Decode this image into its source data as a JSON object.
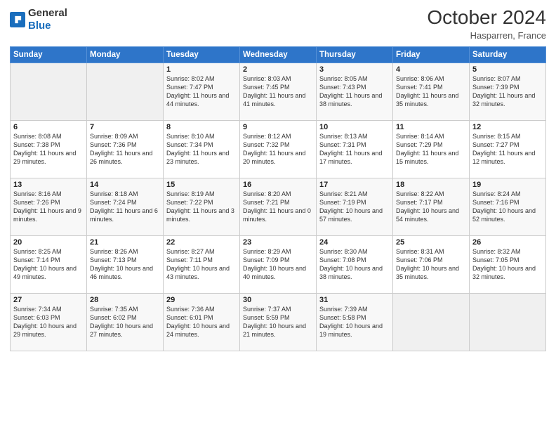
{
  "header": {
    "logo_general": "General",
    "logo_blue": "Blue",
    "month_title": "October 2024",
    "location": "Hasparren, France"
  },
  "weekdays": [
    "Sunday",
    "Monday",
    "Tuesday",
    "Wednesday",
    "Thursday",
    "Friday",
    "Saturday"
  ],
  "weeks": [
    [
      {
        "day": "",
        "sunrise": "",
        "sunset": "",
        "daylight": ""
      },
      {
        "day": "",
        "sunrise": "",
        "sunset": "",
        "daylight": ""
      },
      {
        "day": "1",
        "sunrise": "Sunrise: 8:02 AM",
        "sunset": "Sunset: 7:47 PM",
        "daylight": "Daylight: 11 hours and 44 minutes."
      },
      {
        "day": "2",
        "sunrise": "Sunrise: 8:03 AM",
        "sunset": "Sunset: 7:45 PM",
        "daylight": "Daylight: 11 hours and 41 minutes."
      },
      {
        "day": "3",
        "sunrise": "Sunrise: 8:05 AM",
        "sunset": "Sunset: 7:43 PM",
        "daylight": "Daylight: 11 hours and 38 minutes."
      },
      {
        "day": "4",
        "sunrise": "Sunrise: 8:06 AM",
        "sunset": "Sunset: 7:41 PM",
        "daylight": "Daylight: 11 hours and 35 minutes."
      },
      {
        "day": "5",
        "sunrise": "Sunrise: 8:07 AM",
        "sunset": "Sunset: 7:39 PM",
        "daylight": "Daylight: 11 hours and 32 minutes."
      }
    ],
    [
      {
        "day": "6",
        "sunrise": "Sunrise: 8:08 AM",
        "sunset": "Sunset: 7:38 PM",
        "daylight": "Daylight: 11 hours and 29 minutes."
      },
      {
        "day": "7",
        "sunrise": "Sunrise: 8:09 AM",
        "sunset": "Sunset: 7:36 PM",
        "daylight": "Daylight: 11 hours and 26 minutes."
      },
      {
        "day": "8",
        "sunrise": "Sunrise: 8:10 AM",
        "sunset": "Sunset: 7:34 PM",
        "daylight": "Daylight: 11 hours and 23 minutes."
      },
      {
        "day": "9",
        "sunrise": "Sunrise: 8:12 AM",
        "sunset": "Sunset: 7:32 PM",
        "daylight": "Daylight: 11 hours and 20 minutes."
      },
      {
        "day": "10",
        "sunrise": "Sunrise: 8:13 AM",
        "sunset": "Sunset: 7:31 PM",
        "daylight": "Daylight: 11 hours and 17 minutes."
      },
      {
        "day": "11",
        "sunrise": "Sunrise: 8:14 AM",
        "sunset": "Sunset: 7:29 PM",
        "daylight": "Daylight: 11 hours and 15 minutes."
      },
      {
        "day": "12",
        "sunrise": "Sunrise: 8:15 AM",
        "sunset": "Sunset: 7:27 PM",
        "daylight": "Daylight: 11 hours and 12 minutes."
      }
    ],
    [
      {
        "day": "13",
        "sunrise": "Sunrise: 8:16 AM",
        "sunset": "Sunset: 7:26 PM",
        "daylight": "Daylight: 11 hours and 9 minutes."
      },
      {
        "day": "14",
        "sunrise": "Sunrise: 8:18 AM",
        "sunset": "Sunset: 7:24 PM",
        "daylight": "Daylight: 11 hours and 6 minutes."
      },
      {
        "day": "15",
        "sunrise": "Sunrise: 8:19 AM",
        "sunset": "Sunset: 7:22 PM",
        "daylight": "Daylight: 11 hours and 3 minutes."
      },
      {
        "day": "16",
        "sunrise": "Sunrise: 8:20 AM",
        "sunset": "Sunset: 7:21 PM",
        "daylight": "Daylight: 11 hours and 0 minutes."
      },
      {
        "day": "17",
        "sunrise": "Sunrise: 8:21 AM",
        "sunset": "Sunset: 7:19 PM",
        "daylight": "Daylight: 10 hours and 57 minutes."
      },
      {
        "day": "18",
        "sunrise": "Sunrise: 8:22 AM",
        "sunset": "Sunset: 7:17 PM",
        "daylight": "Daylight: 10 hours and 54 minutes."
      },
      {
        "day": "19",
        "sunrise": "Sunrise: 8:24 AM",
        "sunset": "Sunset: 7:16 PM",
        "daylight": "Daylight: 10 hours and 52 minutes."
      }
    ],
    [
      {
        "day": "20",
        "sunrise": "Sunrise: 8:25 AM",
        "sunset": "Sunset: 7:14 PM",
        "daylight": "Daylight: 10 hours and 49 minutes."
      },
      {
        "day": "21",
        "sunrise": "Sunrise: 8:26 AM",
        "sunset": "Sunset: 7:13 PM",
        "daylight": "Daylight: 10 hours and 46 minutes."
      },
      {
        "day": "22",
        "sunrise": "Sunrise: 8:27 AM",
        "sunset": "Sunset: 7:11 PM",
        "daylight": "Daylight: 10 hours and 43 minutes."
      },
      {
        "day": "23",
        "sunrise": "Sunrise: 8:29 AM",
        "sunset": "Sunset: 7:09 PM",
        "daylight": "Daylight: 10 hours and 40 minutes."
      },
      {
        "day": "24",
        "sunrise": "Sunrise: 8:30 AM",
        "sunset": "Sunset: 7:08 PM",
        "daylight": "Daylight: 10 hours and 38 minutes."
      },
      {
        "day": "25",
        "sunrise": "Sunrise: 8:31 AM",
        "sunset": "Sunset: 7:06 PM",
        "daylight": "Daylight: 10 hours and 35 minutes."
      },
      {
        "day": "26",
        "sunrise": "Sunrise: 8:32 AM",
        "sunset": "Sunset: 7:05 PM",
        "daylight": "Daylight: 10 hours and 32 minutes."
      }
    ],
    [
      {
        "day": "27",
        "sunrise": "Sunrise: 7:34 AM",
        "sunset": "Sunset: 6:03 PM",
        "daylight": "Daylight: 10 hours and 29 minutes."
      },
      {
        "day": "28",
        "sunrise": "Sunrise: 7:35 AM",
        "sunset": "Sunset: 6:02 PM",
        "daylight": "Daylight: 10 hours and 27 minutes."
      },
      {
        "day": "29",
        "sunrise": "Sunrise: 7:36 AM",
        "sunset": "Sunset: 6:01 PM",
        "daylight": "Daylight: 10 hours and 24 minutes."
      },
      {
        "day": "30",
        "sunrise": "Sunrise: 7:37 AM",
        "sunset": "Sunset: 5:59 PM",
        "daylight": "Daylight: 10 hours and 21 minutes."
      },
      {
        "day": "31",
        "sunrise": "Sunrise: 7:39 AM",
        "sunset": "Sunset: 5:58 PM",
        "daylight": "Daylight: 10 hours and 19 minutes."
      },
      {
        "day": "",
        "sunrise": "",
        "sunset": "",
        "daylight": ""
      },
      {
        "day": "",
        "sunrise": "",
        "sunset": "",
        "daylight": ""
      }
    ]
  ]
}
